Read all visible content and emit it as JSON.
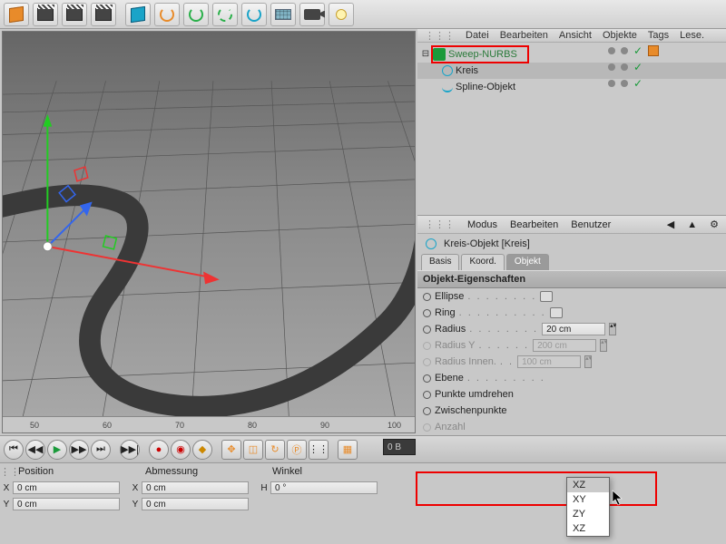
{
  "toolbar": {
    "tooltip": ""
  },
  "obj_menu": {
    "datei": "Datei",
    "bearbeiten": "Bearbeiten",
    "ansicht": "Ansicht",
    "objekte": "Objekte",
    "tags": "Tags",
    "lese": "Lese."
  },
  "tree": {
    "items": [
      {
        "name": "Sweep-NURBS",
        "icon": "sweep"
      },
      {
        "name": "Kreis",
        "icon": "circle"
      },
      {
        "name": "Spline-Objekt",
        "icon": "spline"
      }
    ]
  },
  "ruler": {
    "t50": "50",
    "t60": "60",
    "t70": "70",
    "t80": "80",
    "t90": "90",
    "t100": "100"
  },
  "attr_menu": {
    "modus": "Modus",
    "bearbeiten": "Bearbeiten",
    "benutzer": "Benutzer"
  },
  "attr_head": "Kreis-Objekt [Kreis]",
  "tabs": {
    "basis": "Basis",
    "koord": "Koord.",
    "objekt": "Objekt"
  },
  "section": "Objekt-Eigenschaften",
  "props": {
    "ellipse": "Ellipse",
    "ring": "Ring",
    "radius": "Radius",
    "radius_v": "20 cm",
    "radiusy": "Radius Y",
    "radiusy_v": "200 cm",
    "radiusin": "Radius Innen.",
    "radiusin_v": "100 cm",
    "ebene": "Ebene",
    "punkte": "Punkte umdrehen",
    "zwischen": "Zwischenpunkte",
    "anzahl": "Anzahl"
  },
  "dropdown": {
    "xz": "XZ",
    "xy": "XY",
    "zy": "ZY",
    "xz2": "XZ"
  },
  "transport_frame": "0 B",
  "coords": {
    "position": "Position",
    "abmessung": "Abmessung",
    "winkel": "Winkel",
    "x": "X",
    "y": "Y",
    "h": "H",
    "x_v": "0 cm",
    "y_v": "0 cm",
    "x2_v": "0 cm",
    "y2_v": "0 cm",
    "h_v": "0 °"
  }
}
